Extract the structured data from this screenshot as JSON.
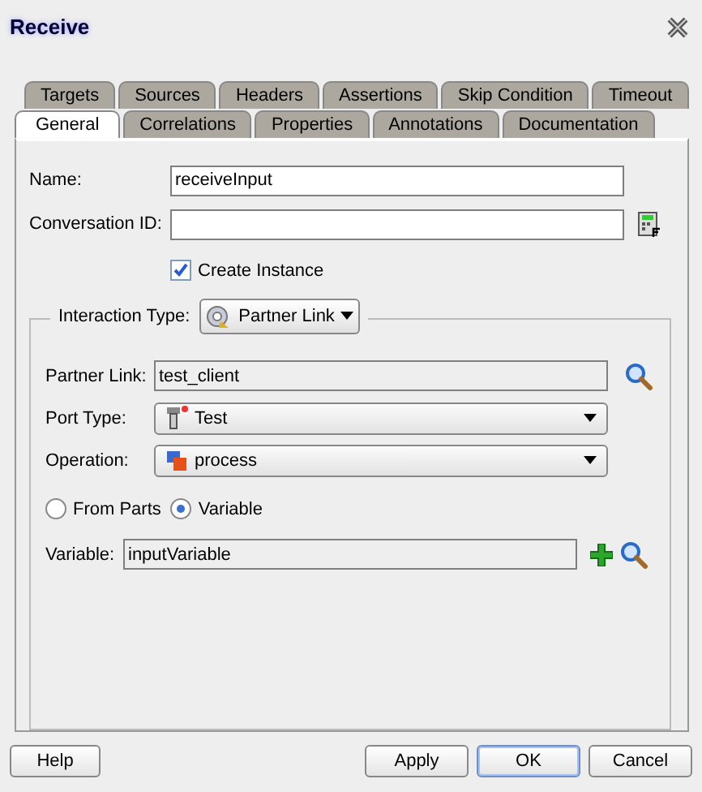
{
  "window": {
    "title": "Receive"
  },
  "tabs_back": [
    {
      "label": "Targets",
      "selected": false
    },
    {
      "label": "Sources",
      "selected": false
    },
    {
      "label": "Headers",
      "selected": false
    },
    {
      "label": "Assertions",
      "selected": false
    },
    {
      "label": "Skip Condition",
      "selected": false
    },
    {
      "label": "Timeout",
      "selected": false
    }
  ],
  "tabs_front": [
    {
      "label": "General",
      "selected": true
    },
    {
      "label": "Correlations",
      "selected": false
    },
    {
      "label": "Properties",
      "selected": false
    },
    {
      "label": "Annotations",
      "selected": false
    },
    {
      "label": "Documentation",
      "selected": false
    }
  ],
  "name": {
    "label": "Name:",
    "value": "receiveInput"
  },
  "conversation_id": {
    "label": "Conversation ID:"
  },
  "create_instance": {
    "label": "Create Instance",
    "checked": true
  },
  "interaction": {
    "label": "Interaction Type:",
    "value": "Partner Link",
    "partner_link": {
      "label": "Partner Link:",
      "value": "test_client"
    },
    "port_type": {
      "label": "Port Type:",
      "value": "Test"
    },
    "operation": {
      "label": "Operation:",
      "value": "process"
    },
    "radios": [
      {
        "label": "From Parts",
        "selected": false
      },
      {
        "label": "Variable",
        "selected": true
      }
    ],
    "variable": {
      "label": "Variable:",
      "value": "inputVariable"
    }
  },
  "buttons": [
    {
      "label": "Help",
      "default": false
    },
    {
      "label": "Apply",
      "default": false
    },
    {
      "label": "OK",
      "default": true
    },
    {
      "label": "Cancel",
      "default": false
    }
  ]
}
